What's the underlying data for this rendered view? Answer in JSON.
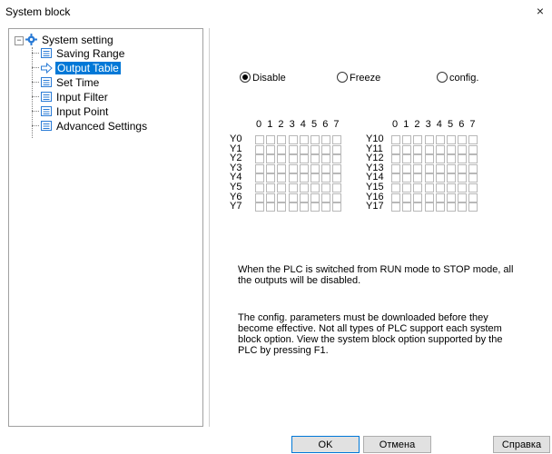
{
  "window": {
    "title": "System block",
    "close_glyph": "×"
  },
  "tree": {
    "root": {
      "label": "System setting",
      "icon": "gear-icon",
      "expander": "−"
    },
    "items": [
      {
        "label": "Saving Range",
        "icon": "list-icon"
      },
      {
        "label": "Output Table",
        "icon": "arrow-right-icon",
        "selected": true
      },
      {
        "label": "Set Time",
        "icon": "list-icon"
      },
      {
        "label": "Input Filter",
        "icon": "list-icon"
      },
      {
        "label": "Input Point",
        "icon": "list-icon"
      },
      {
        "label": "Advanced Settings",
        "icon": "list-icon"
      }
    ]
  },
  "mode": {
    "options": [
      "Disable",
      "Freeze",
      "config."
    ],
    "selected": "Disable"
  },
  "tables": {
    "columns": [
      "0",
      "1",
      "2",
      "3",
      "4",
      "5",
      "6",
      "7"
    ],
    "left_rows": [
      "Y0",
      "Y1",
      "Y2",
      "Y3",
      "Y4",
      "Y5",
      "Y6",
      "Y7"
    ],
    "right_rows": [
      "Y10",
      "Y11",
      "Y12",
      "Y13",
      "Y14",
      "Y15",
      "Y16",
      "Y17"
    ]
  },
  "info": {
    "mode_description": "When the PLC is switched from RUN mode to STOP mode, all the outputs will be disabled.",
    "note": "The config. parameters must be downloaded before they become effective. Not all types of PLC support each system block option. View the system block option supported by the PLC by pressing F1."
  },
  "buttons": {
    "ok": "OK",
    "cancel": "Отмена",
    "help": "Справка"
  },
  "colors": {
    "selection": "#0078d7",
    "button_face": "#e1e1e1"
  }
}
